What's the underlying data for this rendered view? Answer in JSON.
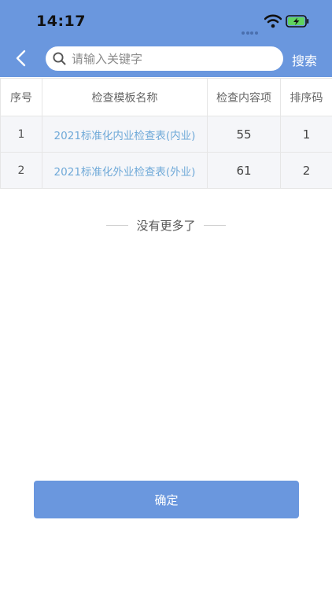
{
  "status_bar": {
    "time": "14:17"
  },
  "header": {
    "search_placeholder": "请输入关键字",
    "search_label": "搜索"
  },
  "table": {
    "columns": [
      "序号",
      "检查模板名称",
      "检查内容项",
      "排序码"
    ],
    "rows": [
      {
        "index": "1",
        "name": "2021标准化内业检查表(内业)",
        "items": "55",
        "sort": "1"
      },
      {
        "index": "2",
        "name": "2021标准化外业检查表(外业)",
        "items": "61",
        "sort": "2"
      }
    ]
  },
  "list_end_text": "没有更多了",
  "confirm_label": "确定",
  "colors": {
    "primary": "#6A97DE",
    "link": "#6fa9d8",
    "battery": "#5fd35f"
  },
  "icons": [
    "back-arrow-icon",
    "search-icon",
    "wifi-icon",
    "battery-charging-icon"
  ]
}
